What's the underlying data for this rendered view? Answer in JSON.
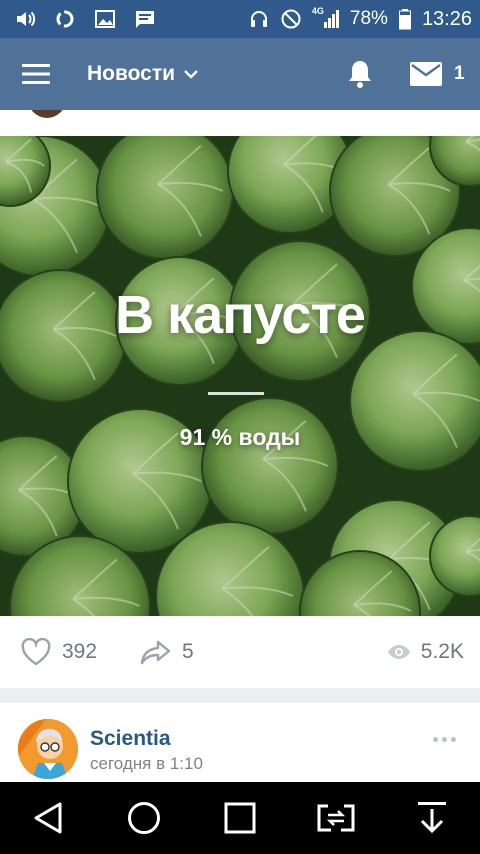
{
  "status_bar": {
    "left_icons": [
      "volume-icon",
      "sync-icon",
      "image-icon",
      "message-icon"
    ],
    "network_label": "4G",
    "battery": "78%",
    "time": "13:26"
  },
  "app_bar": {
    "title": "Новости",
    "notification_icon": "bell-icon",
    "messages_count": "1"
  },
  "post": {
    "image_title": "В капусте",
    "image_subtitle": "91 % воды",
    "likes": "392",
    "shares": "5",
    "views": "5.2K"
  },
  "next_post": {
    "author": "Scientia",
    "time": "сегодня в 1:10"
  },
  "nav_bar": {
    "buttons": [
      "back-icon",
      "home-icon",
      "recents-icon",
      "screen-share-icon",
      "download-icon"
    ]
  },
  "colors": {
    "status_bar": "#2f5a8b",
    "app_bar": "#507299",
    "author_link": "#2a5885",
    "muted": "#6d7885"
  }
}
